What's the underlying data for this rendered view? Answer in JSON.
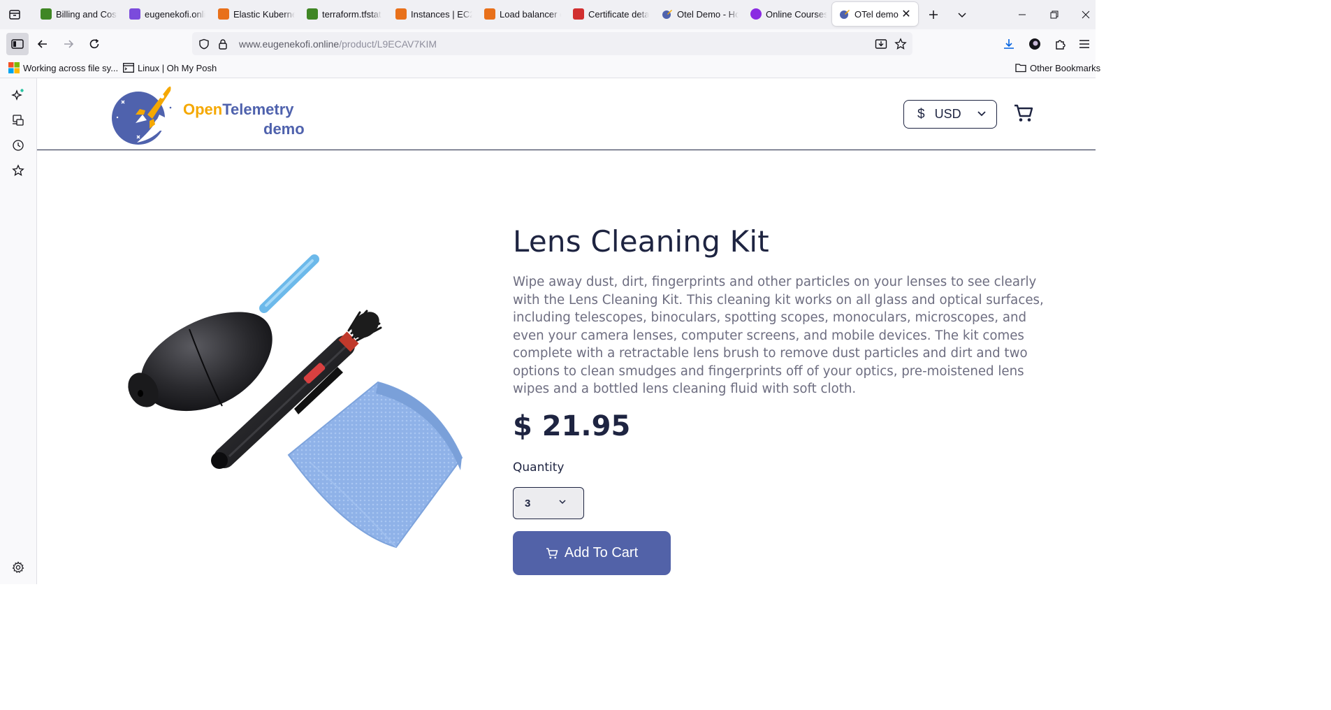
{
  "browser": {
    "tabs": [
      {
        "label": "Billing and Cost",
        "color": "#3f8624",
        "active": false
      },
      {
        "label": "eugenekofi.onli",
        "color": "#7b4bdc",
        "active": false
      },
      {
        "label": "Elastic Kuberne",
        "color": "#e8701a",
        "active": false
      },
      {
        "label": "terraform.tfstat",
        "color": "#3f8624",
        "active": false
      },
      {
        "label": "Instances | EC2",
        "color": "#e8701a",
        "active": false
      },
      {
        "label": "Load balancer c",
        "color": "#e8701a",
        "active": false
      },
      {
        "label": "Certificate deta",
        "color": "#d12f2f",
        "active": false
      },
      {
        "label": "Otel Demo - Ho",
        "color": "#4f62ad",
        "active": false
      },
      {
        "label": "Online Courses",
        "color": "#8a2be2",
        "active": false
      },
      {
        "label": "OTel demo",
        "color": "#4f62ad",
        "active": true
      }
    ],
    "url": {
      "host": "www.eugenekofi.online",
      "path": "/product/L9ECAV7KIM"
    },
    "bookmarks": [
      {
        "label": "Working across file sy...",
        "icon": "windows-icon"
      },
      {
        "label": "Linux | Oh My Posh",
        "icon": "terminal-icon"
      }
    ],
    "other_bookmarks": "Other Bookmarks"
  },
  "site": {
    "logo_word_open": "Open",
    "logo_word_telemetry": "Telemetry",
    "logo_sub": "demo",
    "currency_symbol": "$",
    "currency_code": "USD"
  },
  "product": {
    "name": "Lens Cleaning Kit",
    "description": "Wipe away dust, dirt, fingerprints and other particles on your lenses to see clearly with the Lens Cleaning Kit. This cleaning kit works on all glass and optical surfaces, including telescopes, binoculars, spotting scopes, monoculars, microscopes, and even your camera lenses, computer screens, and mobile devices. The kit comes complete with a retractable lens brush to remove dust particles and dirt and two options to clean smudges and fingerprints off of your optics, pre-moistened lens wipes and a bottled lens cleaning fluid with soft cloth.",
    "price": "$ 21.95",
    "quantity_label": "Quantity",
    "quantity_value": "3",
    "add_to_cart_label": "Add To Cart"
  },
  "colors": {
    "brand_blue": "#4f62ad",
    "brand_orange": "#f5a800",
    "button_blue": "#5262a8",
    "text_navy": "#1e2441",
    "text_gray": "#6d6d80"
  }
}
